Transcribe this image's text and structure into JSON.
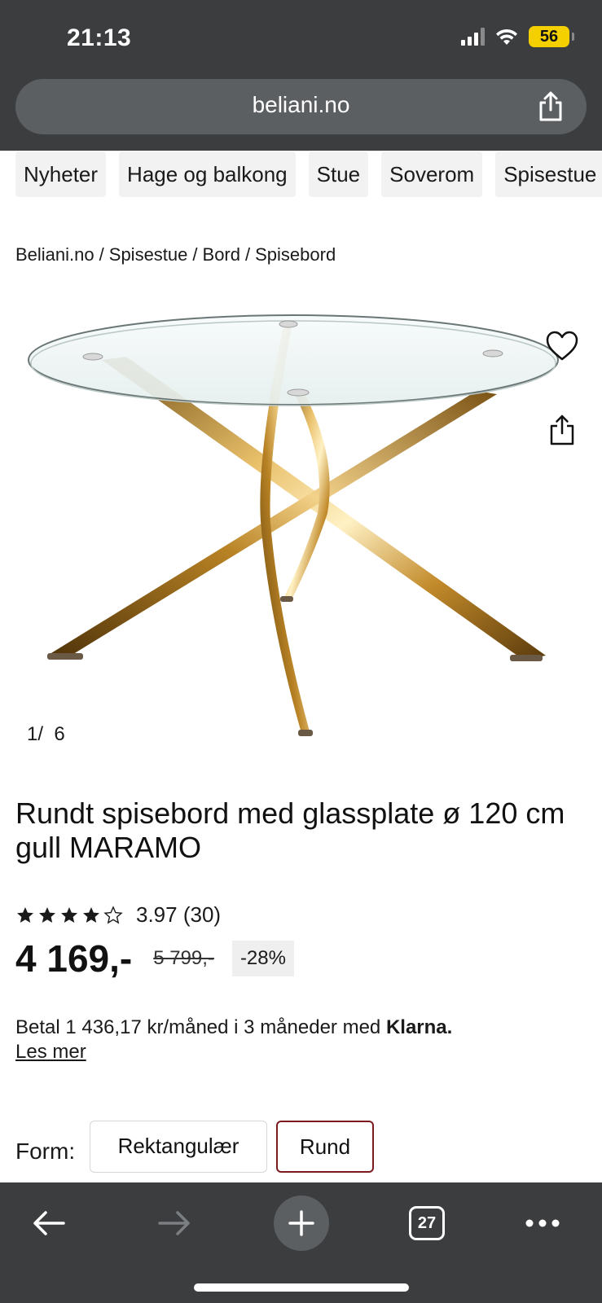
{
  "status": {
    "time": "21:13",
    "battery": "56",
    "icons": [
      "signal-icon",
      "wifi-icon",
      "battery-icon"
    ]
  },
  "browser": {
    "url": "beliani.no",
    "share_icon": "share-icon",
    "nav": {
      "back_icon": "arrow-left-icon",
      "forward_icon": "arrow-right-icon",
      "new_tab_icon": "plus-icon",
      "tab_count": "27",
      "more_icon": "ellipsis-icon"
    }
  },
  "categories": [
    "Nyheter",
    "Hage og balkong",
    "Stue",
    "Soverom",
    "Spisestue"
  ],
  "breadcrumb": [
    "Beliani.no",
    "Spisestue",
    "Bord",
    "Spisebord"
  ],
  "gallery": {
    "counter_current": "1/",
    "counter_total": "6"
  },
  "product": {
    "title": "Rundt spisebord med glassplate ø 120 cm gull MARAMO",
    "rating_value": 3.97,
    "rating_text": "3.97 (30)",
    "price": "4 169,-",
    "old_price": "5 799,-",
    "discount": "-28%",
    "klarna_text": "Betal 1 436,17 kr/måned i 3 måneder med ",
    "klarna_brand": "Klarna.",
    "read_more": "Les mer",
    "form_label": "Form:",
    "form_options": [
      "Rektangulær",
      "Rund"
    ],
    "form_selected": "Rund"
  },
  "colors": {
    "chrome": "#3b3d3f",
    "address_bar": "#5c5f62",
    "selected_border": "#7a1a1f",
    "battery": "#f5d000",
    "gold": "#c99a3a"
  }
}
